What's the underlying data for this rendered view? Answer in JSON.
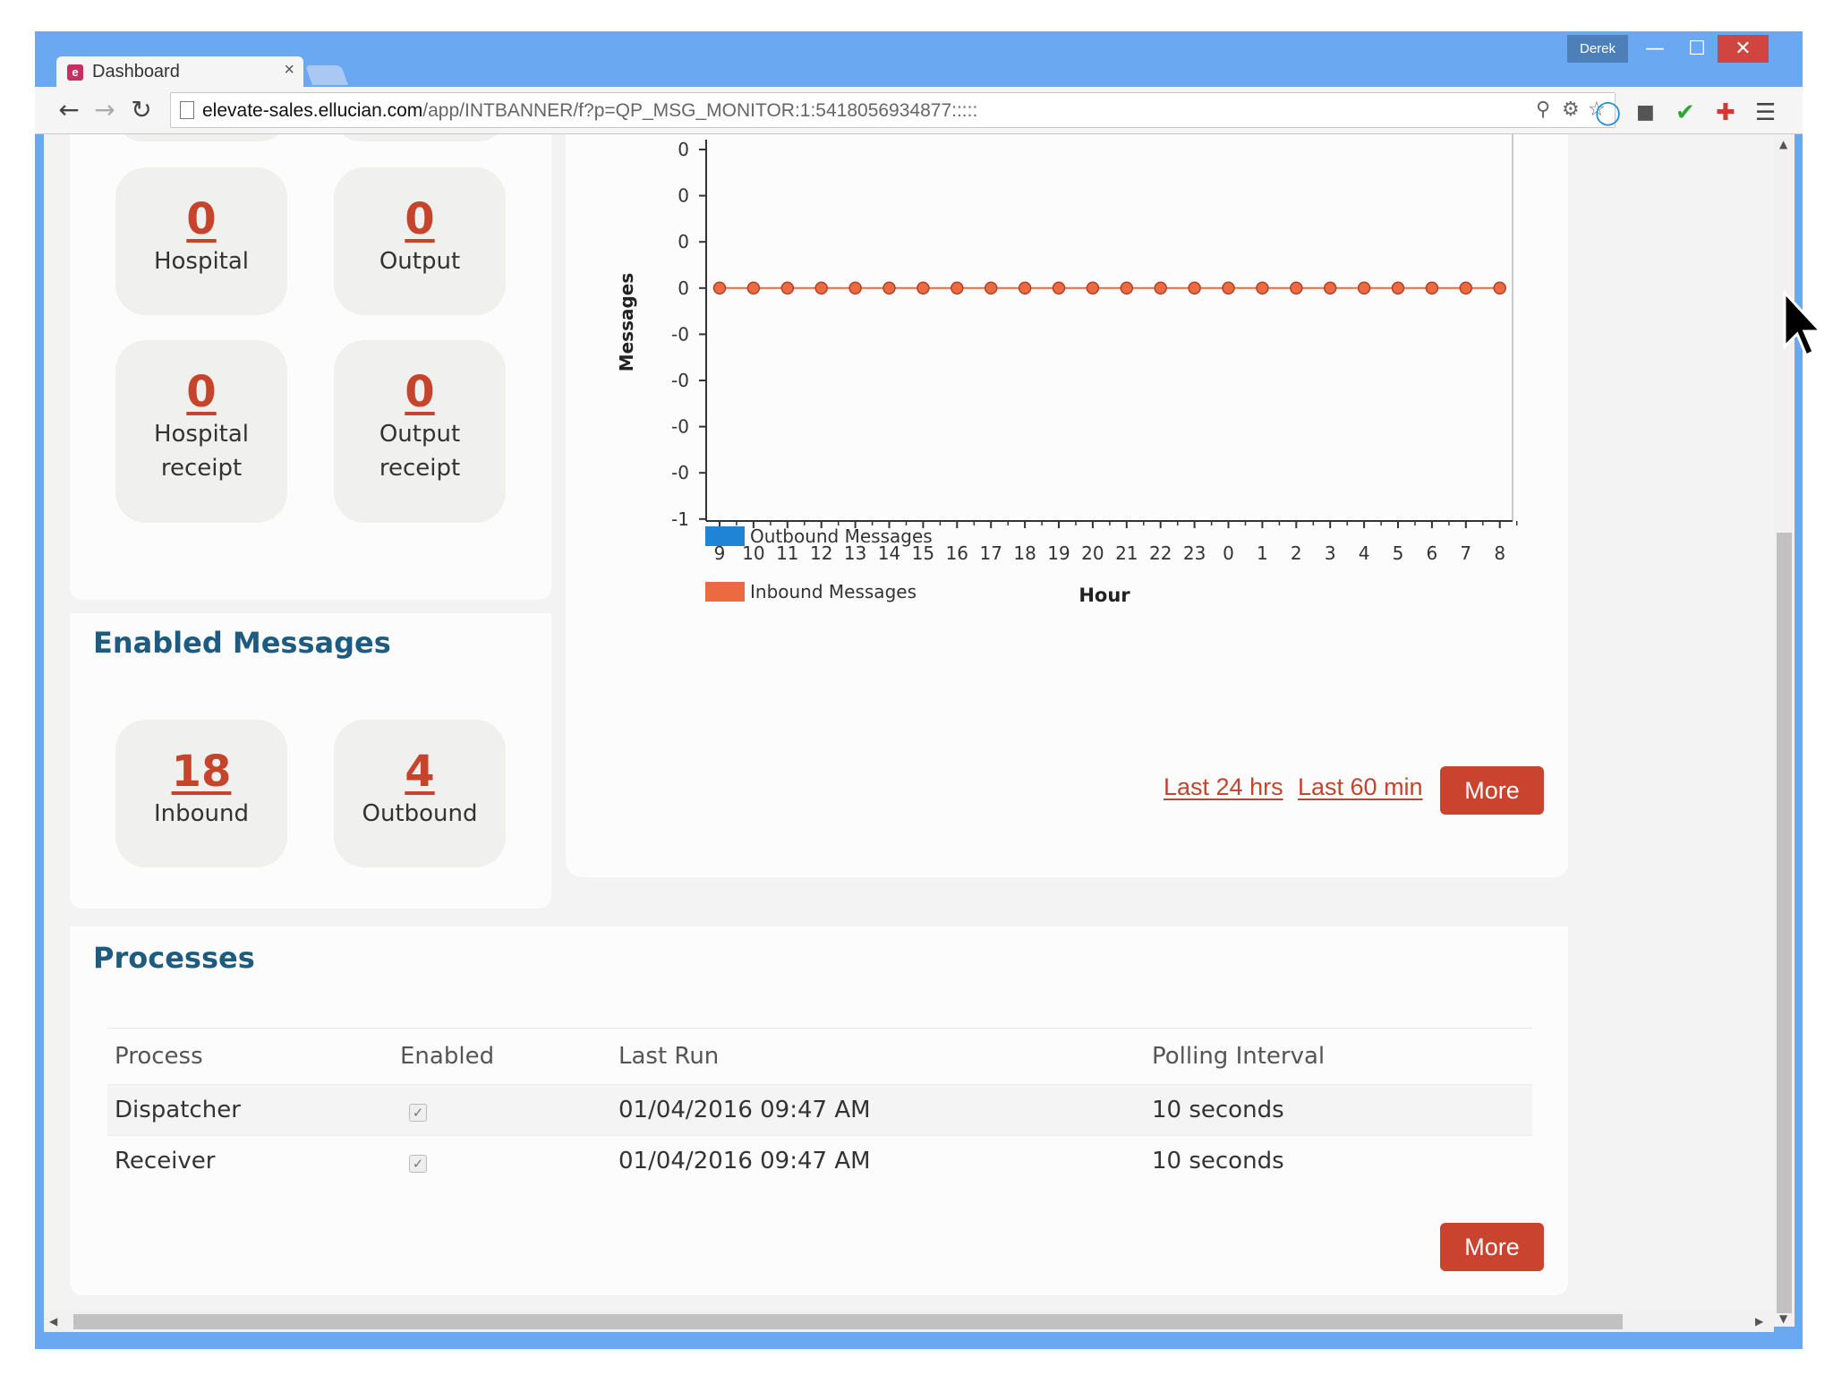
{
  "browser": {
    "user": "Derek",
    "tab": {
      "title": "Dashboard",
      "favicon": "e"
    },
    "url_host": "elevate-sales.ellucian.com",
    "url_path": "/app/INTBANNER/f?p=QP_MSG_MONITOR:1:5418056934877:::::"
  },
  "message_tiles": [
    {
      "value": "0",
      "label": "Hospital"
    },
    {
      "value": "0",
      "label": "Output"
    },
    {
      "value": "0",
      "label": "Hospital receipt"
    },
    {
      "value": "0",
      "label": "Output receipt"
    }
  ],
  "enabled_messages": {
    "title": "Enabled Messages",
    "tiles": [
      {
        "value": "18",
        "label": "Inbound"
      },
      {
        "value": "4",
        "label": "Outbound"
      }
    ]
  },
  "chart_controls": {
    "last24": "Last 24 hrs",
    "last60": "Last 60 min",
    "more": "More"
  },
  "chart_data": {
    "type": "line",
    "xlabel": "Hour",
    "ylabel": "Messages",
    "x": [
      "9",
      "10",
      "11",
      "12",
      "13",
      "14",
      "15",
      "16",
      "17",
      "18",
      "19",
      "20",
      "21",
      "22",
      "23",
      "0",
      "1",
      "2",
      "3",
      "4",
      "5",
      "6",
      "7",
      "8"
    ],
    "y_tick_labels": [
      "0",
      "0",
      "0",
      "0",
      "-0",
      "-0",
      "-0",
      "-0",
      "-1"
    ],
    "ylim": [
      -1,
      0.5
    ],
    "series": [
      {
        "name": "Outbound Messages",
        "color": "#1f84d6",
        "values": []
      },
      {
        "name": "Inbound Messages",
        "color": "#ec6a3f",
        "values": [
          0,
          0,
          0,
          0,
          0,
          0,
          0,
          0,
          0,
          0,
          0,
          0,
          0,
          0,
          0,
          0,
          0,
          0,
          0,
          0,
          0,
          0,
          0,
          0
        ]
      }
    ],
    "legend": "bottom-left",
    "grid": false
  },
  "processes": {
    "title": "Processes",
    "columns": [
      "Process",
      "Enabled",
      "Last Run",
      "Polling Interval"
    ],
    "rows": [
      {
        "process": "Dispatcher",
        "enabled": true,
        "last_run": "01/04/2016 09:47 AM",
        "polling": "10 seconds"
      },
      {
        "process": "Receiver",
        "enabled": true,
        "last_run": "01/04/2016 09:47 AM",
        "polling": "10 seconds"
      }
    ],
    "more": "More"
  },
  "icons": {
    "check": "✓",
    "close": "✕"
  }
}
